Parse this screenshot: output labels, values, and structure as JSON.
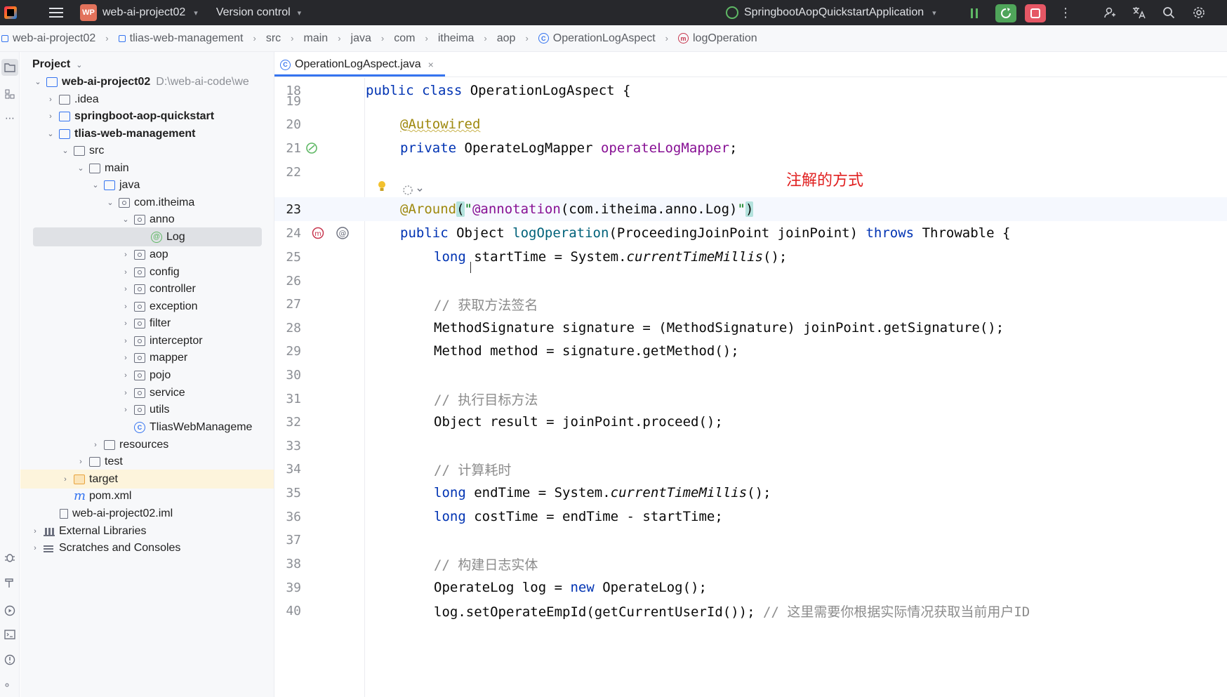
{
  "titlebar": {
    "project_badge": "WP",
    "project_name": "web-ai-project02",
    "version_control": "Version control",
    "run_config": "SpringbootAopQuickstartApplication"
  },
  "breadcrumb": [
    "web-ai-project02",
    "tlias-web-management",
    "src",
    "main",
    "java",
    "com",
    "itheima",
    "aop",
    "OperationLogAspect",
    "logOperation"
  ],
  "project_panel": {
    "title": "Project",
    "tree": [
      {
        "label": "web-ai-project02",
        "extra": "D:\\web-ai-code\\we",
        "bold": true
      },
      {
        "label": ".idea"
      },
      {
        "label": "springboot-aop-quickstart",
        "bold": true
      },
      {
        "label": "tlias-web-management",
        "bold": true
      },
      {
        "label": "src"
      },
      {
        "label": "main"
      },
      {
        "label": "java"
      },
      {
        "label": "com.itheima"
      },
      {
        "label": "anno"
      },
      {
        "label": "Log"
      },
      {
        "label": "aop"
      },
      {
        "label": "config"
      },
      {
        "label": "controller"
      },
      {
        "label": "exception"
      },
      {
        "label": "filter"
      },
      {
        "label": "interceptor"
      },
      {
        "label": "mapper"
      },
      {
        "label": "pojo"
      },
      {
        "label": "service"
      },
      {
        "label": "utils"
      },
      {
        "label": "TliasWebManageme"
      },
      {
        "label": "resources"
      },
      {
        "label": "test"
      },
      {
        "label": "target"
      },
      {
        "label": "pom.xml"
      },
      {
        "label": "web-ai-project02.iml"
      },
      {
        "label": "External Libraries"
      },
      {
        "label": "Scratches and Consoles"
      }
    ]
  },
  "editor": {
    "tab": "OperationLogAspect.java",
    "annotation_note": "注解的方式",
    "lines": {
      "l18": "18",
      "l19": "19",
      "l20": "20",
      "l21": "21",
      "l22": "22",
      "l23": "23",
      "l24": "24",
      "l25": "25",
      "l26": "26",
      "l27": "27",
      "l28": "28",
      "l29": "29",
      "l30": "30",
      "l31": "31",
      "l32": "32",
      "l33": "33",
      "l34": "34",
      "l35": "35",
      "l36": "36",
      "l37": "37",
      "l38": "38",
      "l39": "39",
      "l40": "40"
    },
    "code": {
      "c18_kw": "public class ",
      "c18_rest": "OperationLogAspect {",
      "c20_ann": "@Autowired",
      "c21_kw": "private ",
      "c21_type": "OperateLogMapper ",
      "c21_fld": "operateLogMapper",
      "c21_end": ";",
      "c23_ann": "@Around",
      "c23_open": "(",
      "c23_q1": "\"",
      "c23_str": "@annotation",
      "c23_str2": "(com.itheima.anno.Log)",
      "c23_q2": "\"",
      "c23_close": ")",
      "c24_kw": "public ",
      "c24_type": "Object ",
      "c24_fn": "logOperation",
      "c24_args": "(ProceedingJoinPoint joinPoint) ",
      "c24_kw2": "throws ",
      "c24_rest": "Throwable {",
      "c25_kw": "long",
      "c25_a": " startTime = System.",
      "c25_it": "currentTimeMillis",
      "c25_end": "();",
      "c27_cmt": "// 获取方法签名",
      "c28": "MethodSignature signature = (MethodSignature) joinPoint.getSignature();",
      "c29": "Method method = signature.getMethod();",
      "c31_cmt": "// 执行目标方法",
      "c32": "Object result = joinPoint.proceed();",
      "c34_cmt": "// 计算耗时",
      "c35_kw": "long",
      "c35_a": " endTime = System.",
      "c35_it": "currentTimeMillis",
      "c35_end": "();",
      "c36_kw": "long",
      "c36_a": " costTime = endTime - startTime;",
      "c38_cmt": "// 构建日志实体",
      "c39_a": "OperateLog log = ",
      "c39_kw": "new ",
      "c39_b": "OperateLog();",
      "c40_a": "log.setOperateEmpId(getCurrentUserId()); ",
      "c40_cmt": "// 这里需要你根据实际情况获取当前用户ID"
    }
  },
  "colors": {
    "keyword": "#0033b3",
    "annotation": "#9e880d",
    "field": "#871094",
    "string": "#067d17",
    "comment": "#8c8c8c",
    "accent": "#3574f0",
    "note_red": "#e02020"
  }
}
